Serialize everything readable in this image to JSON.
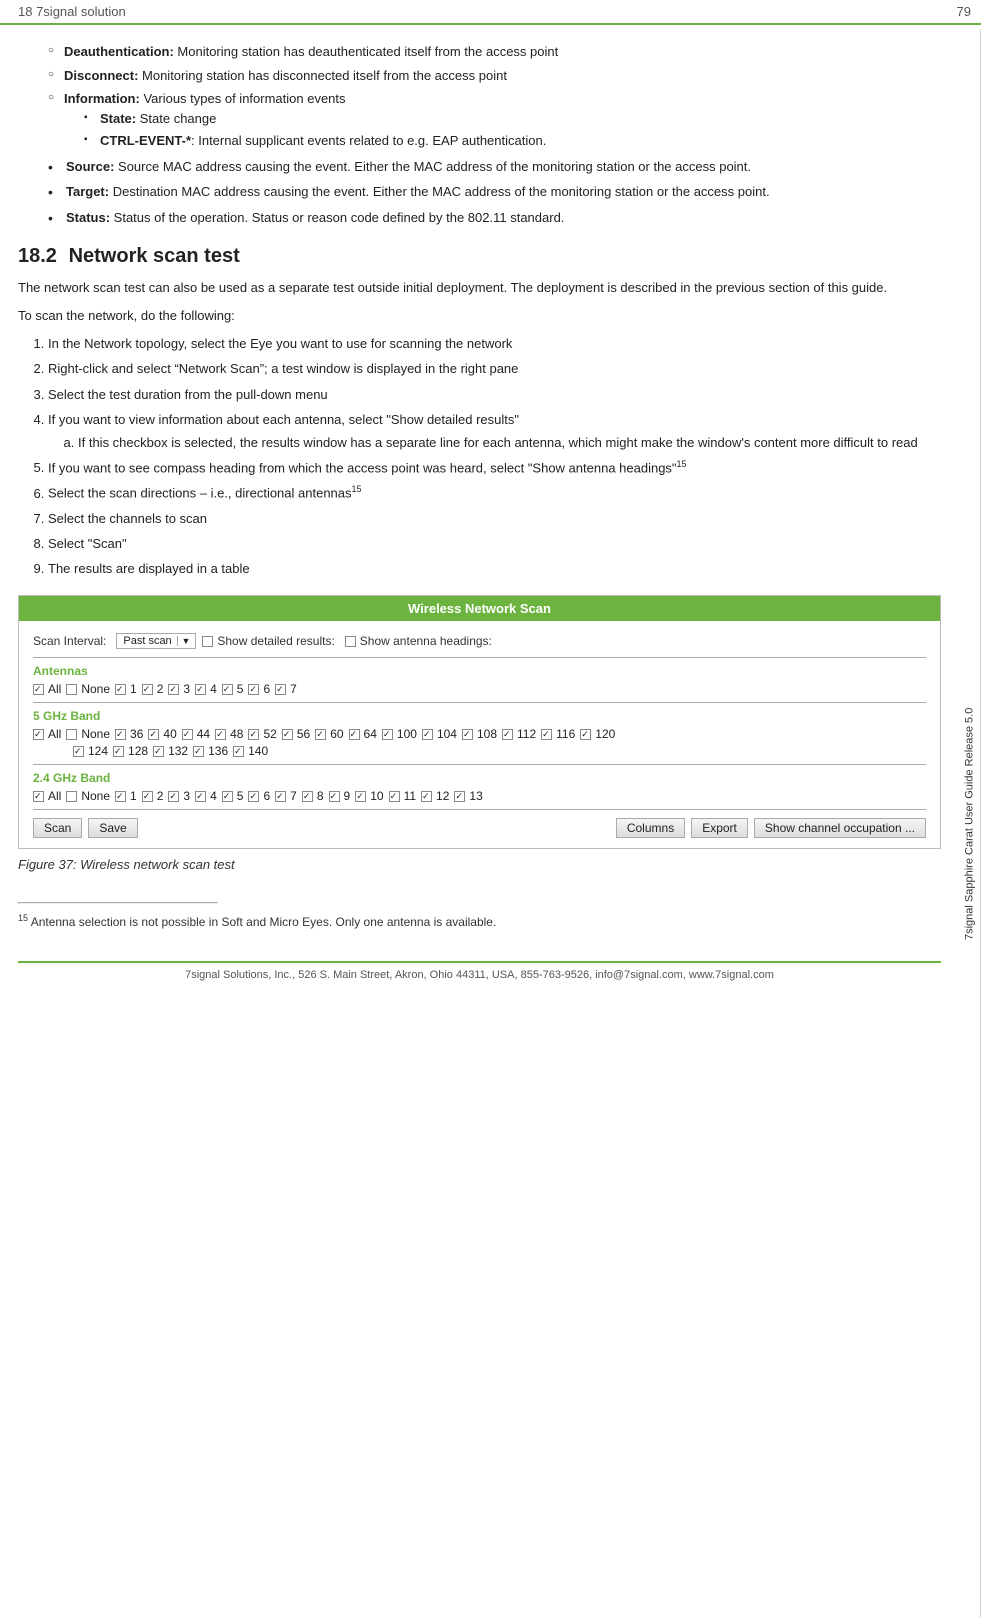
{
  "header": {
    "left_text": "18 7signal solution",
    "right_text": "79"
  },
  "side_label": "7signal Sapphire Carat User Guide Release 5.0",
  "bullet_section": {
    "circle_items": [
      {
        "label": "Deauthentication:",
        "text": " Monitoring station has deauthenticated itself from the access point"
      },
      {
        "label": "Disconnect:",
        "text": " Monitoring station has disconnected itself from the access point"
      },
      {
        "label": "Information:",
        "text": " Various types of information events",
        "sub_items": [
          {
            "label": "State:",
            "text": " State change"
          },
          {
            "label": "CTRL-EVENT-*",
            "text": ": Internal supplicant events related to e.g. EAP authentication."
          }
        ]
      }
    ],
    "bullet_items": [
      {
        "label": "Source:",
        "text": " Source MAC address causing the event. Either the MAC address of the monitoring station or the access point."
      },
      {
        "label": "Target:",
        "text": " Destination MAC address causing the event. Either the MAC address of the monitoring station or the access point."
      },
      {
        "label": "Status:",
        "text": " Status of the operation. Status or reason code defined by the 802.11 standard."
      }
    ]
  },
  "section": {
    "number": "18.2",
    "title": "Network scan test"
  },
  "intro_text": "The network scan test can also be used as a separate test outside initial deployment. The deployment is described in the previous section of this guide.",
  "scan_intro": "To scan the network, do the following:",
  "steps": [
    {
      "text": "In the Network topology, select the Eye you want to use for scanning the network"
    },
    {
      "text": "Right-click and select “Network Scan”; a test window is displayed in the right pane"
    },
    {
      "text": "Select the test duration from the pull-down menu"
    },
    {
      "text": "If you want to view information about each antenna, select “Show detailed results”",
      "sub": [
        {
          "text": "If this checkbox is selected, the results window has a separate line for each antenna, which might make the window’s content more difficult to read"
        }
      ]
    },
    {
      "text": "If you want to see compass heading from which the access point was heard, select “Show antenna headings”",
      "sup": "15"
    },
    {
      "text": "Select the scan directions – i.e., directional antennas",
      "sup": "15"
    },
    {
      "text": "Select the channels to scan"
    },
    {
      "text": "Select “Scan”"
    },
    {
      "text": "The results are displayed in a table"
    }
  ],
  "widget": {
    "title": "Wireless Network Scan",
    "scan_interval_label": "Scan Interval:",
    "scan_interval_value": "Past scan",
    "show_detailed_label": "Show detailed results:",
    "show_antenna_label": "Show antenna headings:",
    "antennas_label": "Antennas",
    "antennas_items": [
      "All",
      "None",
      "1",
      "2",
      "3",
      "4",
      "5",
      "6",
      "7"
    ],
    "antennas_checked": [
      "All",
      "1",
      "2",
      "3",
      "4",
      "5",
      "6",
      "7"
    ],
    "band5_label": "5 GHz Band",
    "band5_row1": [
      "All",
      "None",
      "36",
      "40",
      "44",
      "48",
      "52",
      "56",
      "60",
      "64",
      "100",
      "104",
      "108",
      "112",
      "116",
      "120"
    ],
    "band5_row2": [
      "124",
      "128",
      "132",
      "136",
      "140"
    ],
    "band5_checked": [
      "All",
      "36",
      "40",
      "44",
      "48",
      "52",
      "56",
      "60",
      "64",
      "100",
      "104",
      "108",
      "112",
      "116",
      "120",
      "124",
      "128",
      "132",
      "136",
      "140"
    ],
    "band24_label": "2.4 GHz Band",
    "band24_items": [
      "All",
      "None",
      "1",
      "2",
      "3",
      "4",
      "5",
      "6",
      "7",
      "8",
      "9",
      "10",
      "11",
      "12",
      "13"
    ],
    "band24_checked": [
      "All",
      "1",
      "2",
      "3",
      "4",
      "5",
      "6",
      "7",
      "8",
      "9",
      "10",
      "11",
      "12",
      "13"
    ],
    "buttons": {
      "scan": "Scan",
      "save": "Save",
      "columns": "Columns",
      "export": "Export",
      "show_channel": "Show channel occupation ..."
    }
  },
  "figure_caption": "Figure 37: Wireless network scan test",
  "footnote": {
    "number": "15",
    "text": "Antenna selection is not possible in Soft and Micro Eyes. Only one antenna is available."
  },
  "footer": {
    "text": "7signal Solutions, Inc., 526 S. Main Street, Akron, Ohio 44311, USA, 855-763-9526, info@7signal.com, www.7signal.com"
  }
}
